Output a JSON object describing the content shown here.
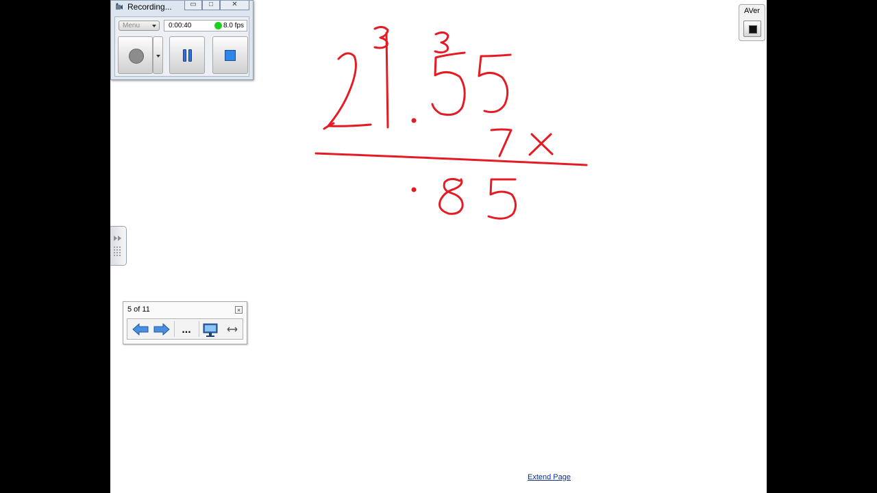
{
  "recorder": {
    "title": "Recording...",
    "menu_label": "Menu",
    "elapsed": "0:00:40",
    "fps": "8.0 fps",
    "status_color": "#1ed01e"
  },
  "aver": {
    "label": "AVer"
  },
  "navigator": {
    "page_indicator": "5 of 11",
    "more_label": "..."
  },
  "canvas": {
    "ink_color": "#e41b23",
    "written": {
      "carries": [
        "3",
        "3"
      ],
      "multiplicand": "21.55",
      "multiplier": "7",
      "operator": "x",
      "partial_result": ".85"
    },
    "extend_link": "Extend Page"
  }
}
